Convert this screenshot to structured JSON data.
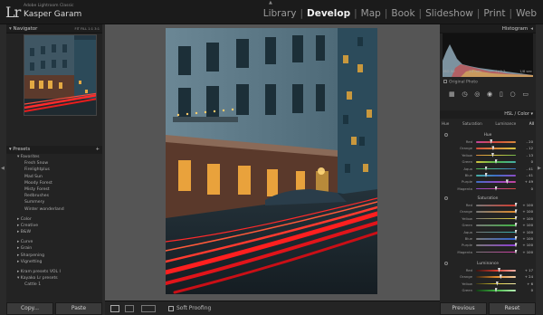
{
  "app": {
    "logo": "Lr",
    "subtitle": "Adobe Lightroom Classic",
    "user": "Kasper Garam"
  },
  "modules": [
    {
      "label": "Library",
      "active": false
    },
    {
      "label": "Develop",
      "active": true
    },
    {
      "label": "Map",
      "active": false
    },
    {
      "label": "Book",
      "active": false
    },
    {
      "label": "Slideshow",
      "active": false
    },
    {
      "label": "Print",
      "active": false
    },
    {
      "label": "Web",
      "active": false
    }
  ],
  "navigator": {
    "title": "Navigator",
    "zoom_options": "FIT  FILL  1:1  3:1"
  },
  "presets": {
    "title": "Presets",
    "items": [
      {
        "label": "▾ Favorites",
        "kind": "fold"
      },
      {
        "label": "Fresh Snow",
        "kind": "child"
      },
      {
        "label": "Firelightplus",
        "kind": "child"
      },
      {
        "label": "Mad Sun",
        "kind": "child"
      },
      {
        "label": "Moody Forest",
        "kind": "child"
      },
      {
        "label": "Misty Forest",
        "kind": "child"
      },
      {
        "label": "Redbrushes",
        "kind": "child"
      },
      {
        "label": "Summery",
        "kind": "child"
      },
      {
        "label": "Winter wonderland",
        "kind": "child"
      },
      {
        "label": "▸ Color",
        "kind": "fold gap"
      },
      {
        "label": "▸ Creative",
        "kind": "fold"
      },
      {
        "label": "▸ B&W",
        "kind": "fold"
      },
      {
        "label": "▸ Curve",
        "kind": "fold gap"
      },
      {
        "label": "▸ Grain",
        "kind": "fold"
      },
      {
        "label": "▸ Sharpening",
        "kind": "fold"
      },
      {
        "label": "▸ Vignetting",
        "kind": "fold"
      },
      {
        "label": "▸ Kram presets VOL I",
        "kind": "fold gap"
      },
      {
        "label": "▾ Kayako Lr presets",
        "kind": "fold"
      },
      {
        "label": "Cattle 1",
        "kind": "child"
      }
    ]
  },
  "left_buttons": {
    "copy": "Copy...",
    "paste": "Paste"
  },
  "toolbar": {
    "soft_proofing": "Soft Proofing"
  },
  "histogram": {
    "title": "Histogram",
    "stats": [
      "ISO 50",
      "24 mm",
      "f / 2.2",
      "1/8 sec"
    ],
    "original_photo": "Original Photo"
  },
  "hsl": {
    "title": "HSL / Color",
    "mode": "All",
    "tabs": [
      "Hue",
      "Saturation",
      "Luminance",
      "All"
    ],
    "hue": {
      "title": "Hue",
      "rows": [
        {
          "label": "Red",
          "value": "- 20",
          "pos": 0.38,
          "grad": "linear-gradient(90deg,#c2449b,#d24b3b,#d98a3c)"
        },
        {
          "label": "Orange",
          "value": "- 12",
          "pos": 0.43,
          "grad": "linear-gradient(90deg,#d24b3b,#d98a3c,#d6c53f)"
        },
        {
          "label": "Yellow",
          "value": "- 13",
          "pos": 0.42,
          "grad": "linear-gradient(90deg,#d98a3c,#d6c53f,#72b84a)"
        },
        {
          "label": "Green",
          "value": "0",
          "pos": 0.5,
          "grad": "linear-gradient(90deg,#d6c53f,#4fb34a,#45b0a6)"
        },
        {
          "label": "Aqua",
          "value": "- 41",
          "pos": 0.25,
          "grad": "linear-gradient(90deg,#4fb34a,#45b0a6,#3e6fc4)"
        },
        {
          "label": "Blue",
          "value": "- 41",
          "pos": 0.25,
          "grad": "linear-gradient(90deg,#45b0a6,#3e6fc4,#8d4cc7)"
        },
        {
          "label": "Purple",
          "value": "+ 49",
          "pos": 0.78,
          "grad": "linear-gradient(90deg,#3e6fc4,#8d4cc7,#c2449b)"
        },
        {
          "label": "Magenta",
          "value": "0",
          "pos": 0.5,
          "grad": "linear-gradient(90deg,#8d4cc7,#c2449b,#d24b3b)"
        }
      ]
    },
    "saturation": {
      "title": "Saturation",
      "rows": [
        {
          "label": "Red",
          "value": "+ 100",
          "pos": 1,
          "grad": "linear-gradient(90deg,#777,#d23a2e)"
        },
        {
          "label": "Orange",
          "value": "+ 100",
          "pos": 1,
          "grad": "linear-gradient(90deg,#777,#e08a2c)"
        },
        {
          "label": "Yellow",
          "value": "+ 100",
          "pos": 1,
          "grad": "linear-gradient(90deg,#777,#e2cf35)"
        },
        {
          "label": "Green",
          "value": "+ 100",
          "pos": 1,
          "grad": "linear-gradient(90deg,#777,#3fb542)"
        },
        {
          "label": "Aqua",
          "value": "+ 100",
          "pos": 1,
          "grad": "linear-gradient(90deg,#777,#35b3b0)"
        },
        {
          "label": "Blue",
          "value": "+ 100",
          "pos": 1,
          "grad": "linear-gradient(90deg,#777,#2f63d6)"
        },
        {
          "label": "Purple",
          "value": "+ 100",
          "pos": 1,
          "grad": "linear-gradient(90deg,#777,#8f3cd6)"
        },
        {
          "label": "Magenta",
          "value": "+ 100",
          "pos": 1,
          "grad": "linear-gradient(90deg,#777,#d438a8)"
        }
      ]
    },
    "luminance": {
      "title": "Luminance",
      "rows": [
        {
          "label": "Red",
          "value": "+ 17",
          "pos": 0.58,
          "grad": "linear-gradient(90deg,#3a1410,#d23a2e,#f3b2a8)"
        },
        {
          "label": "Orange",
          "value": "+ 24",
          "pos": 0.62,
          "grad": "linear-gradient(90deg,#3a2410,#e08a2c,#f3d0a8)"
        },
        {
          "label": "Yellow",
          "value": "+ 6",
          "pos": 0.53,
          "grad": "linear-gradient(90deg,#3a3410,#e2cf35,#f5eeb0)"
        },
        {
          "label": "Green",
          "value": "0",
          "pos": 0.5,
          "grad": "linear-gradient(90deg,#103a12,#3fb542,#b8f0b6)"
        }
      ]
    }
  },
  "right_buttons": {
    "previous": "Previous",
    "reset": "Reset"
  }
}
